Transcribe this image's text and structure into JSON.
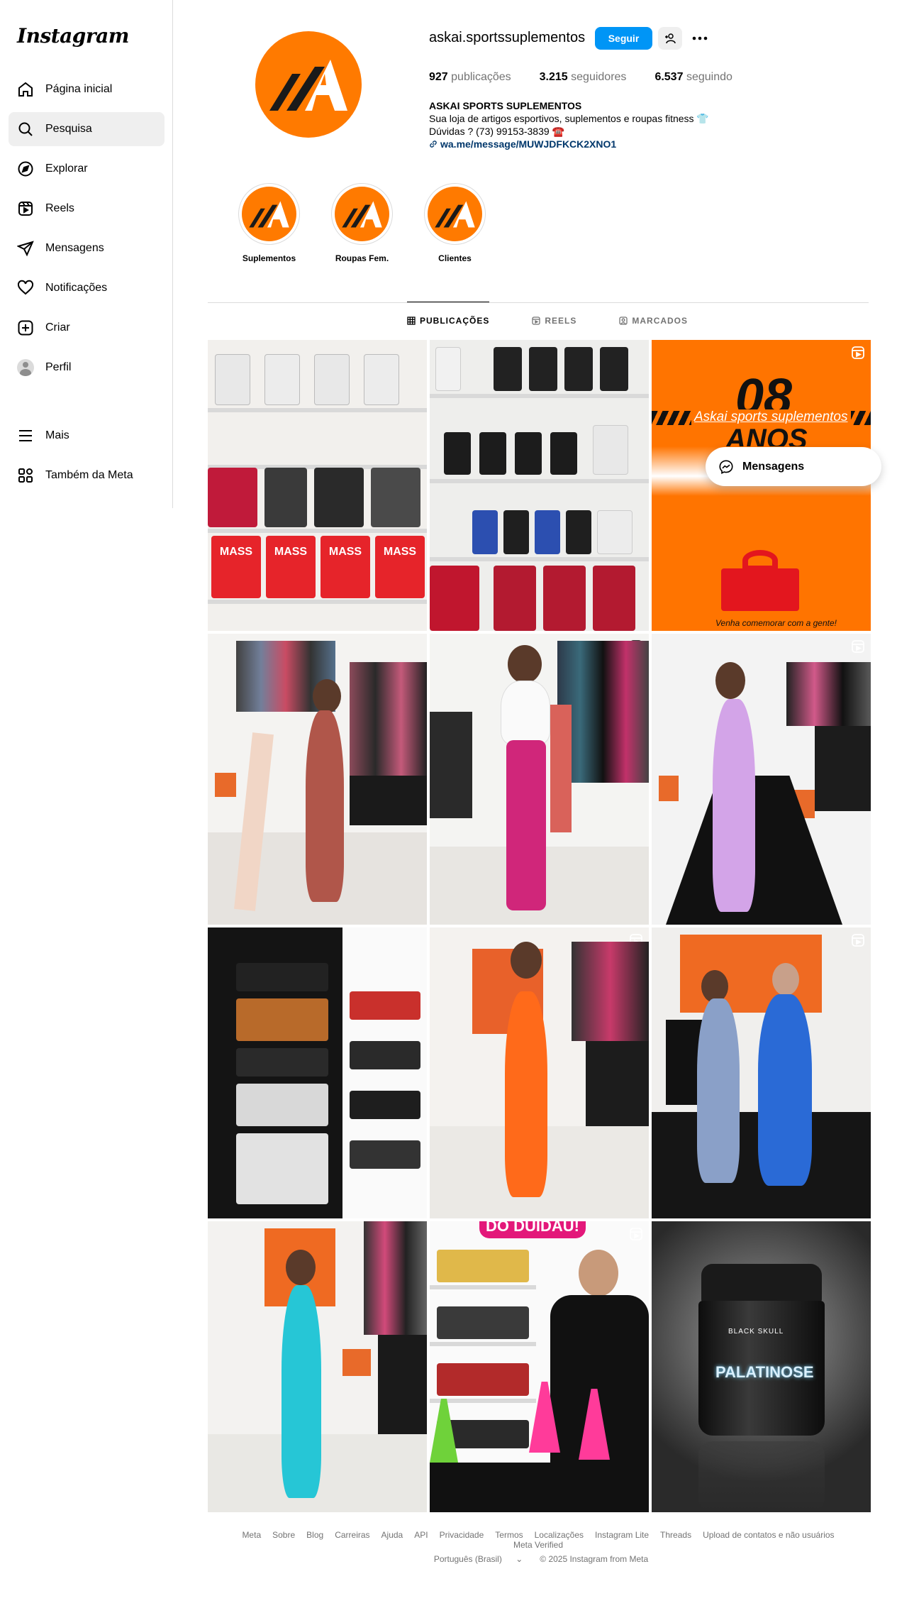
{
  "app": {
    "logo_text": "Instagram"
  },
  "sidebar": {
    "items": [
      {
        "label": "Página inicial",
        "icon": "home-icon"
      },
      {
        "label": "Pesquisa",
        "icon": "search-icon"
      },
      {
        "label": "Explorar",
        "icon": "compass-icon"
      },
      {
        "label": "Reels",
        "icon": "reels-icon"
      },
      {
        "label": "Mensagens",
        "icon": "send-icon"
      },
      {
        "label": "Notificações",
        "icon": "heart-icon"
      },
      {
        "label": "Criar",
        "icon": "plus-square-icon"
      },
      {
        "label": "Perfil",
        "icon": "avatar-icon"
      }
    ],
    "bottom": [
      {
        "label": "Mais",
        "icon": "menu-icon"
      },
      {
        "label": "Também da Meta",
        "icon": "meta-apps-icon"
      }
    ]
  },
  "profile": {
    "username": "askai.sportssuplementos",
    "follow_label": "Seguir",
    "stats": {
      "posts_count": "927",
      "posts_label": "publicações",
      "followers_count": "3.215",
      "followers_label": "seguidores",
      "following_count": "6.537",
      "following_label": "seguindo"
    },
    "bio": {
      "name": "ASKAI SPORTS SUPLEMENTOS",
      "line1": "Sua loja de artigos esportivos, suplementos e roupas fitness 👕",
      "line2": "Dúvidas ? (73) 99153-3839 ☎️",
      "link": "wa.me/message/MUWJDFKCK2XNO1"
    },
    "logo_letter": "A"
  },
  "highlights": [
    {
      "label": "Suplementos"
    },
    {
      "label": "Roupas Fem."
    },
    {
      "label": "Clientes"
    }
  ],
  "tabs": [
    {
      "label": "PUBLICAÇÕES",
      "active": true
    },
    {
      "label": "REELS",
      "active": false
    },
    {
      "label": "MARCADOS",
      "active": false
    }
  ],
  "posts": {
    "anniversary_store": "Askai sports suplementos",
    "anniversary_number": "08",
    "anniversary_word": "ANOS",
    "anniversary_cta": "Venha comemorar com a gente!",
    "jar_brand": "BLACK SKULL",
    "jar_product": "PALATINOSE",
    "promo_banner": "DO DUIDAU!",
    "mass_label": "MASS"
  },
  "messages_popup": {
    "label": "Mensagens"
  },
  "footer": {
    "links": [
      "Meta",
      "Sobre",
      "Blog",
      "Carreiras",
      "Ajuda",
      "API",
      "Privacidade",
      "Termos",
      "Localizações",
      "Instagram Lite",
      "Threads",
      "Upload de contatos e não usuários",
      "Meta Verified"
    ],
    "language": "Português (Brasil)",
    "copyright": "© 2025 Instagram from Meta"
  },
  "colors": {
    "brand_orange": "#ff7a00",
    "follow_blue": "#0095f6",
    "link_blue": "#00376b"
  }
}
